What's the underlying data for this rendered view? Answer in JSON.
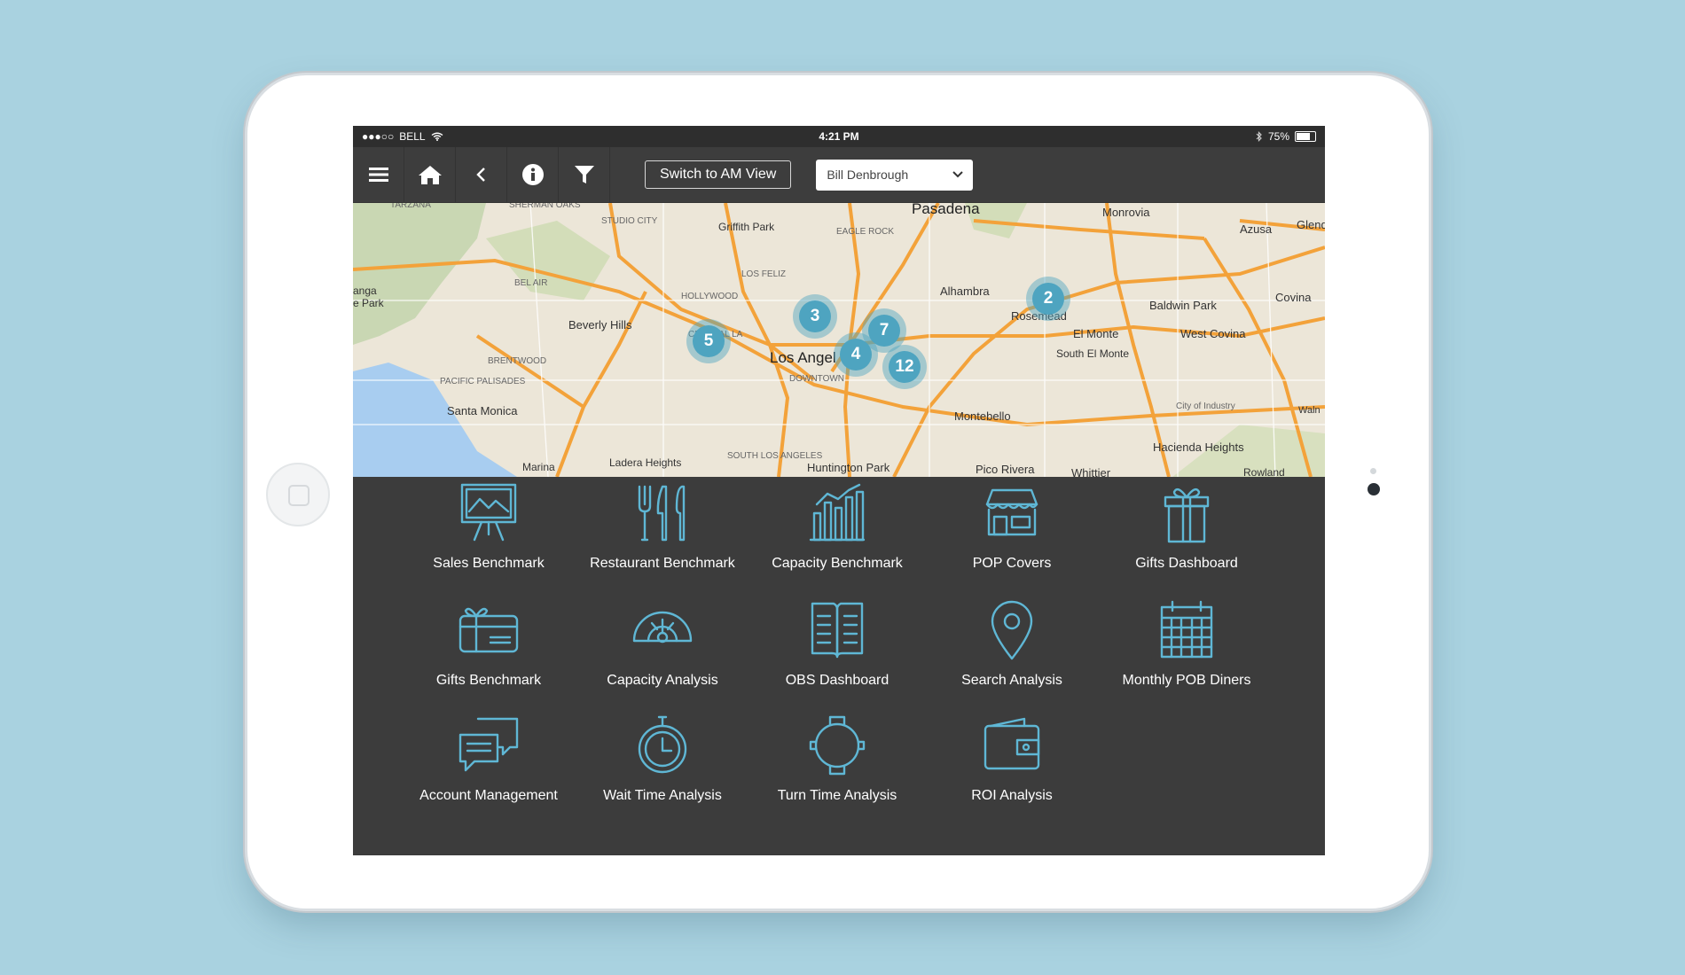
{
  "status": {
    "carrier": "BELL",
    "time": "4:21 PM",
    "battery": "75%"
  },
  "toolbar": {
    "menu_icon": "hamburger-icon",
    "home_icon": "home-icon",
    "back_icon": "back-chevron-icon",
    "info_icon": "info-icon",
    "filter_icon": "filter-icon",
    "switch_label": "Switch to AM View",
    "user_select": "Bill Denbrough"
  },
  "map": {
    "places": [
      "Pasadena",
      "Monrovia",
      "Azusa",
      "Glend",
      "Griffith Park",
      "STUDIO CITY",
      "SHERMAN OAKS",
      "TARZANA",
      "EAGLE ROCK",
      "Alhambra",
      "Rosemead",
      "Baldwin Park",
      "Covina",
      "El Monte",
      "West Covina",
      "Beverly Hills",
      "Los Angel",
      "South El Monte",
      "Santa Monica",
      "Montebello",
      "City of Industry",
      "Waln",
      "Hacienda Heights",
      "Pico Rivera",
      "Whittier",
      "Rowland",
      "Huntington Park",
      "Ladera Heights",
      "Marina",
      "BEL AIR",
      "HOLLYWOOD",
      "LOS FELIZ",
      "CENTRAL LA",
      "BRENTWOOD",
      "PACIFIC PALISADES",
      "DOWNTOWN",
      "SOUTH LOS ANGELES",
      "anga",
      "e Park"
    ],
    "clusters": [
      "3",
      "2",
      "7",
      "5",
      "4",
      "12"
    ]
  },
  "dashboards": [
    {
      "label": "Sales Benchmark",
      "icon": "presentation-board-icon"
    },
    {
      "label": "Restaurant Benchmark",
      "icon": "utensils-icon"
    },
    {
      "label": "Capacity Benchmark",
      "icon": "bar-chart-icon"
    },
    {
      "label": "POP Covers",
      "icon": "storefront-icon"
    },
    {
      "label": "Gifts Dashboard",
      "icon": "gift-box-icon"
    },
    {
      "label": "Gifts Benchmark",
      "icon": "gift-card-icon"
    },
    {
      "label": "Capacity Analysis",
      "icon": "gauge-icon"
    },
    {
      "label": "OBS Dashboard",
      "icon": "open-book-icon"
    },
    {
      "label": "Search Analysis",
      "icon": "map-pin-icon"
    },
    {
      "label": "Monthly POB Diners",
      "icon": "calendar-icon"
    },
    {
      "label": "Account Management",
      "icon": "chat-bubbles-icon"
    },
    {
      "label": "Wait Time Analysis",
      "icon": "stopwatch-icon"
    },
    {
      "label": "Turn Time Analysis",
      "icon": "watch-icon"
    },
    {
      "label": "ROI Analysis",
      "icon": "wallet-icon"
    }
  ]
}
